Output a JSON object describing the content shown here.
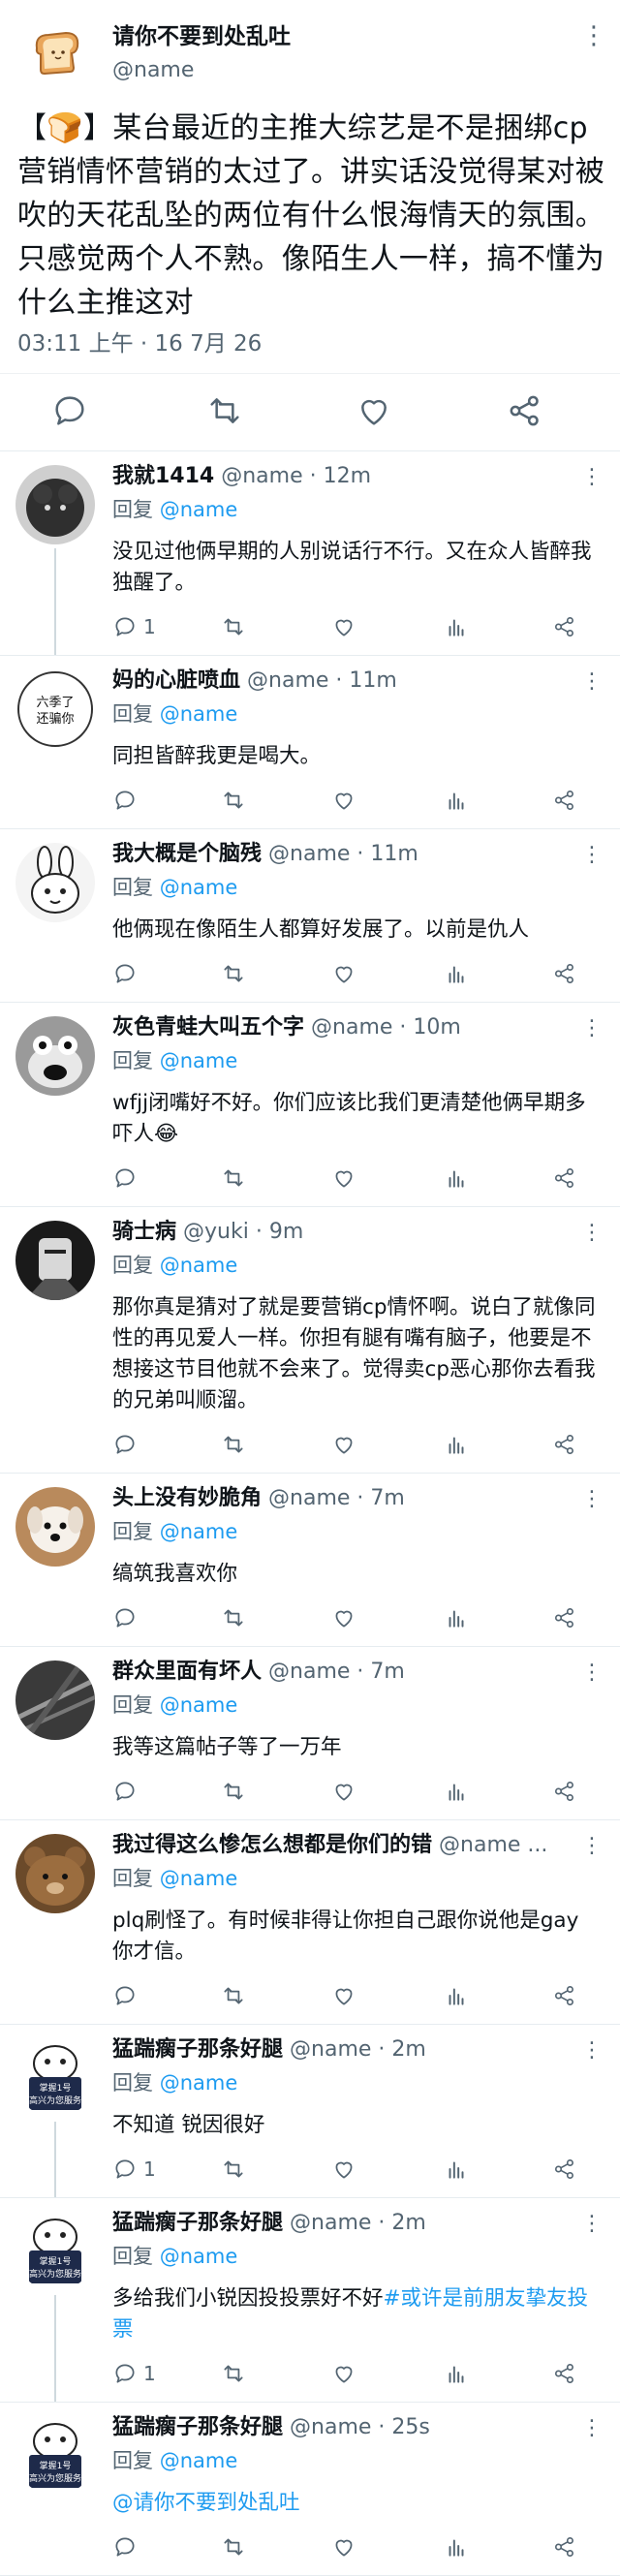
{
  "main_tweet": {
    "author_name": "请你不要到处乱吐",
    "author_handle": "@name",
    "text": "【🍞】某台最近的主推大综艺是不是捆绑cp营销情怀营销的太过了。讲实话没觉得某对被吹的天花乱坠的两位有什么恨海情天的氛围。只感觉两个人不熟。像陌生人一样，搞不懂为什么主推这对",
    "timestamp": "03:11 上午 · 16 7月 26"
  },
  "icons": {
    "more": "more-vertical-icon",
    "reply": "reply-bubble-icon",
    "retweet": "retweet-icon",
    "like": "heart-icon",
    "views": "bar-chart-icon",
    "share": "share-icon"
  },
  "replying_label": "回复",
  "replies": [
    {
      "name": "我就1414",
      "handle": "@name",
      "time": "· 12m",
      "replying_to": "@name",
      "text": "没见过他俩早期的人别说话行不行。又在众人皆醉我独醒了。",
      "reply_count": "1",
      "thread_line": true
    },
    {
      "name": "妈的心脏喷血",
      "handle": "@name",
      "time": "· 11m",
      "replying_to": "@name",
      "text": "同担皆醉我更是喝大。",
      "reply_count": "",
      "thread_line": false,
      "avatar_text": "六季了 还骗你"
    },
    {
      "name": "我大概是个脑残",
      "handle": "@name",
      "time": "· 11m",
      "replying_to": "@name",
      "text": "他俩现在像陌生人都算好发展了。以前是仇人",
      "reply_count": "",
      "thread_line": false
    },
    {
      "name": "灰色青蛙大叫五个字",
      "handle": "@name",
      "time": "· 10m",
      "replying_to": "@name",
      "text": "wfjj闭嘴好不好。你们应该比我们更清楚他俩早期多吓人😂",
      "reply_count": "",
      "thread_line": false
    },
    {
      "name": "骑士病",
      "handle": "@yuki",
      "time": "· 9m",
      "replying_to": "@name",
      "text": "那你真是猜对了就是要营销cp情怀啊。说白了就像同性的再见爱人一样。你担有腿有嘴有脑子，他要是不想接这节目他就不会来了。觉得卖cp恶心那你去看我的兄弟叫顺溜。",
      "reply_count": "",
      "thread_line": false
    },
    {
      "name": "头上没有妙脆角",
      "handle": "@name",
      "time": "· 7m",
      "replying_to": "@name",
      "text": "缟筑我喜欢你",
      "reply_count": "",
      "thread_line": false
    },
    {
      "name": "群众里面有坏人",
      "handle": "@name",
      "time": "· 7m",
      "replying_to": "@name",
      "text": "我等这篇帖子等了一万年",
      "reply_count": "",
      "thread_line": false
    },
    {
      "name": "我过得这么惨怎么想都是你们的错",
      "handle": "@name",
      "time": "...",
      "replying_to": "@name",
      "text": "plq刷怪了。有时候非得让你担自己跟你说他是gay你才信。",
      "reply_count": "",
      "thread_line": false
    },
    {
      "name": "猛踹瘸子那条好腿",
      "handle": "@name",
      "time": "· 2m",
      "replying_to": "@name",
      "text": "不知道 锐因很好",
      "reply_count": "1",
      "thread_line": true,
      "avatar_text": "掌握1号 高兴为您服务"
    },
    {
      "name": "猛踹瘸子那条好腿",
      "handle": "@name",
      "time": "· 2m",
      "replying_to": "@name",
      "text": "多给我们小锐因投投票好不好",
      "link_text": "#或许是前朋友挚友投票",
      "reply_count": "1",
      "thread_line": true,
      "avatar_text": "掌握1号 高兴为您服务"
    },
    {
      "name": "猛踹瘸子那条好腿",
      "handle": "@name",
      "time": "· 25s",
      "replying_to": "@name",
      "text": "",
      "link_text": "@请你不要到处乱吐",
      "reply_count": "",
      "thread_line": false,
      "avatar_text": "掌握1号 高兴为您服务"
    }
  ]
}
